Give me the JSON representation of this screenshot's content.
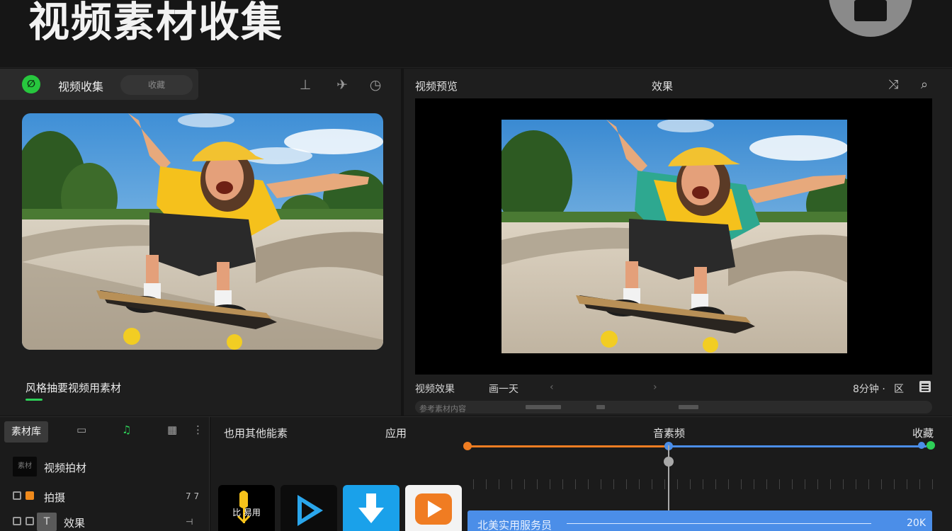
{
  "header": {
    "title": "视频素材收集"
  },
  "left_panel": {
    "title": "视频收集",
    "pill": "收藏",
    "tools": [
      "pen-icon",
      "pin-icon",
      "clock-icon"
    ],
    "caption": "风格抽要视频用素材"
  },
  "right_panel": {
    "title": "视频预览",
    "center_label": "效果",
    "playback": {
      "label": "视频效果",
      "time": "画一天",
      "prev": "‹",
      "next": "›",
      "right_label": "8分钟 ·",
      "right_label2": "区"
    },
    "scrubber_label": "参考素材内容"
  },
  "library": {
    "tab_active": "素材库",
    "tabs": [
      "monitor-icon",
      "music-icon",
      "grid-icon",
      "more-icon"
    ],
    "items": [
      {
        "name": "视频拍材",
        "thumb": "素材"
      },
      {
        "name": "拍摄",
        "value": "7 7"
      },
      {
        "name": "效果",
        "value": "⊣"
      }
    ]
  },
  "mid_panel": {
    "left_label": "也用其他能素",
    "right_label": "应用"
  },
  "apps": [
    {
      "name": "app-tile-1",
      "label": "比  易用"
    },
    {
      "name": "app-tile-2",
      "label": ""
    },
    {
      "name": "app-tile-3",
      "label": ""
    },
    {
      "name": "app-tile-4",
      "label": ""
    }
  ],
  "timeline": {
    "center_label": "音素频",
    "right_label": "收藏",
    "clip_label": "北美实用服务员",
    "clip_size": "20K"
  },
  "colors": {
    "accent_green": "#2ed058",
    "orange": "#ef7d22",
    "blue": "#4b8ee8"
  }
}
